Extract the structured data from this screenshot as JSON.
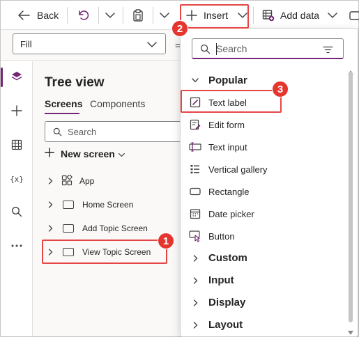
{
  "toolbar": {
    "back_label": "Back",
    "insert_label": "Insert",
    "add_data_label": "Add data"
  },
  "formula": {
    "property_value": "Fill"
  },
  "tree": {
    "title": "Tree view",
    "tabs": [
      {
        "label": "Screens",
        "active": true
      },
      {
        "label": "Components",
        "active": false
      }
    ],
    "search_placeholder": "Search",
    "new_screen_label": "New screen",
    "items": [
      {
        "label": "App",
        "icon": "app-icon"
      },
      {
        "label": "Home Screen",
        "icon": "screen-icon"
      },
      {
        "label": "Add Topic Screen",
        "icon": "screen-icon"
      },
      {
        "label": "View Topic Screen",
        "icon": "screen-icon"
      }
    ]
  },
  "insert_menu": {
    "search_placeholder": "Search",
    "groups": [
      {
        "label": "Popular",
        "expanded": true
      },
      {
        "label": "Custom",
        "expanded": false
      },
      {
        "label": "Input",
        "expanded": false
      },
      {
        "label": "Display",
        "expanded": false
      },
      {
        "label": "Layout",
        "expanded": false
      }
    ],
    "popular_items": [
      {
        "label": "Text label",
        "icon": "text-label-icon"
      },
      {
        "label": "Edit form",
        "icon": "edit-form-icon"
      },
      {
        "label": "Text input",
        "icon": "text-input-icon"
      },
      {
        "label": "Vertical gallery",
        "icon": "vertical-gallery-icon"
      },
      {
        "label": "Rectangle",
        "icon": "rectangle-icon"
      },
      {
        "label": "Date picker",
        "icon": "date-picker-icon"
      },
      {
        "label": "Button",
        "icon": "button-icon"
      }
    ]
  },
  "annotations": [
    {
      "number": "1",
      "target": "View Topic Screen"
    },
    {
      "number": "2",
      "target": "Insert"
    },
    {
      "number": "3",
      "target": "Text label"
    }
  ],
  "colors": {
    "accent": "#742774",
    "highlight": "#e64545",
    "badge": "#e5352f"
  }
}
